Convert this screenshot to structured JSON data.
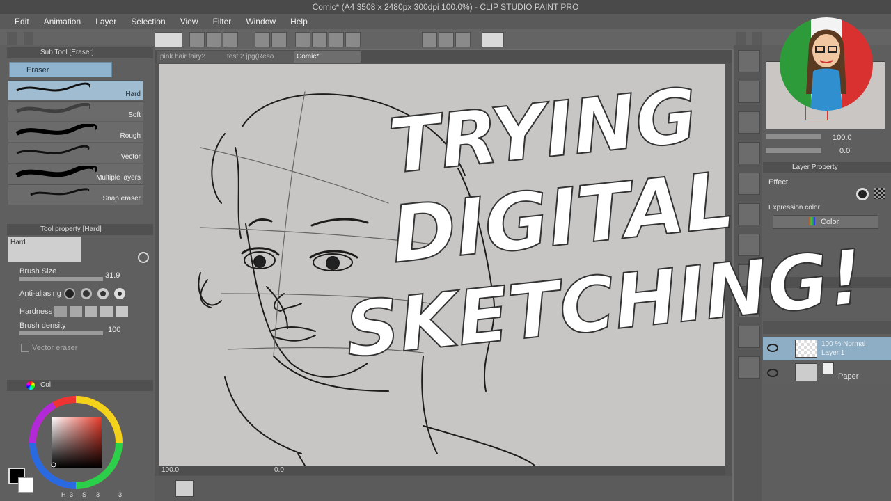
{
  "window": {
    "title": "Comic* (A4 3508 x 2480px 300dpi 100.0%) - CLIP STUDIO PAINT PRO"
  },
  "menu": [
    "Edit",
    "Animation",
    "Layer",
    "Selection",
    "View",
    "Filter",
    "Window",
    "Help"
  ],
  "subtool_panel": {
    "title": "Sub Tool [Eraser]",
    "group": "Eraser",
    "brushes": [
      "Hard",
      "Soft",
      "Rough",
      "Vector",
      "Multiple layers",
      "Snap eraser"
    ]
  },
  "tool_property": {
    "title": "Tool property [Hard]",
    "preview_label": "Hard",
    "brush_size_label": "Brush Size",
    "brush_size_value": "31.9",
    "antialiasing_label": "Anti-aliasing",
    "hardness_label": "Hardness",
    "density_label": "Brush density",
    "density_value": "100",
    "vector_eraser_label": "Vector eraser"
  },
  "color_panel": {
    "title": "Col",
    "main_color": "#000000",
    "sub_color": "#ffffff",
    "indicator_h": "H",
    "indicator_s": "S",
    "hue_value": "3",
    "sat_value": "3",
    "val_value": "3"
  },
  "doc_tabs": [
    "pink hair fairy2",
    "test 2.jpg(Reso",
    "Comic*"
  ],
  "status": {
    "zoom": "100.0",
    "rotation": "0.0"
  },
  "navigator": {
    "zoom": "100.0",
    "rotation": "0.0"
  },
  "layer_property": {
    "title": "Layer Property",
    "effect_label": "Effect",
    "expression_color_label": "Expression color",
    "expression_color_value": "Color"
  },
  "layers": [
    {
      "blend": "100 % Normal",
      "name": "Layer 1"
    },
    {
      "blend": "",
      "name": "Paper"
    }
  ],
  "overlay_text": [
    "TRYING",
    "DIGITAL",
    "SKETCHING!"
  ],
  "colors": {
    "accent_selected": "#9fbcd1",
    "panel": "#5f5f5f",
    "paper": "#c8c6c4"
  }
}
